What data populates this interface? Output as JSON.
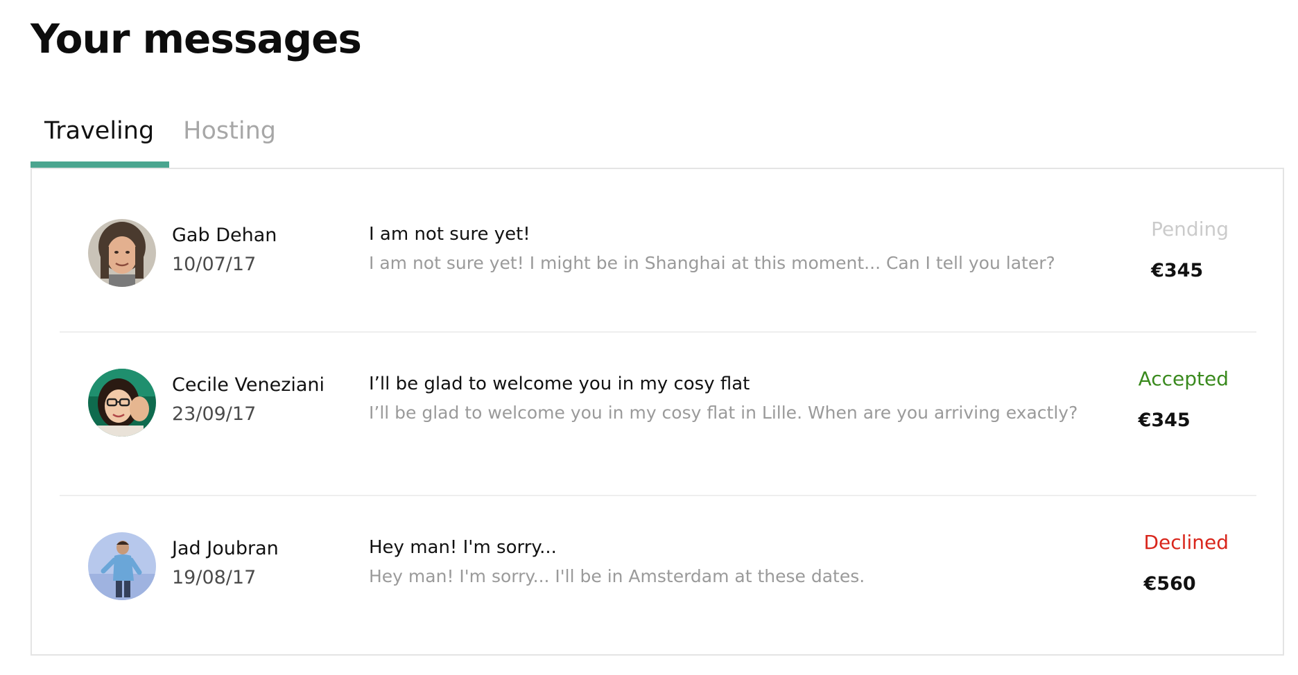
{
  "page": {
    "title": "Your messages"
  },
  "tabs": [
    {
      "label": "Traveling",
      "active": true
    },
    {
      "label": "Hosting",
      "active": false
    }
  ],
  "colors": {
    "accent": "#4aa58f",
    "pending": "#cbcbcb",
    "accepted": "#3a8a1e",
    "declined": "#d9261c",
    "muted": "#9a9a9a"
  },
  "threads": [
    {
      "name": "Gab Dehan",
      "date": "10/07/17",
      "subject": "I am not sure yet!",
      "preview": "I am not sure yet! I might be in Shanghai at this moment... Can I tell you later?",
      "status": "Pending",
      "status_color": "#cbcbcb",
      "price": "€345",
      "avatar_icon": "avatar-photo"
    },
    {
      "name": "Cecile Veneziani",
      "date": "23/09/17",
      "subject": "I’ll be glad to welcome you in my cosy flat",
      "preview": "I’ll be glad to welcome you in my cosy flat in Lille. When are you arriving exactly?",
      "status": "Accepted",
      "status_color": "#3a8a1e",
      "price": "€345",
      "avatar_icon": "avatar-photo"
    },
    {
      "name": "Jad Joubran",
      "date": "19/08/17",
      "subject": "Hey man! I'm sorry...",
      "preview": "Hey man! I'm sorry... I'll be in Amsterdam at these dates.",
      "status": "Declined",
      "status_color": "#d9261c",
      "price": "€560",
      "avatar_icon": "avatar-photo"
    }
  ]
}
